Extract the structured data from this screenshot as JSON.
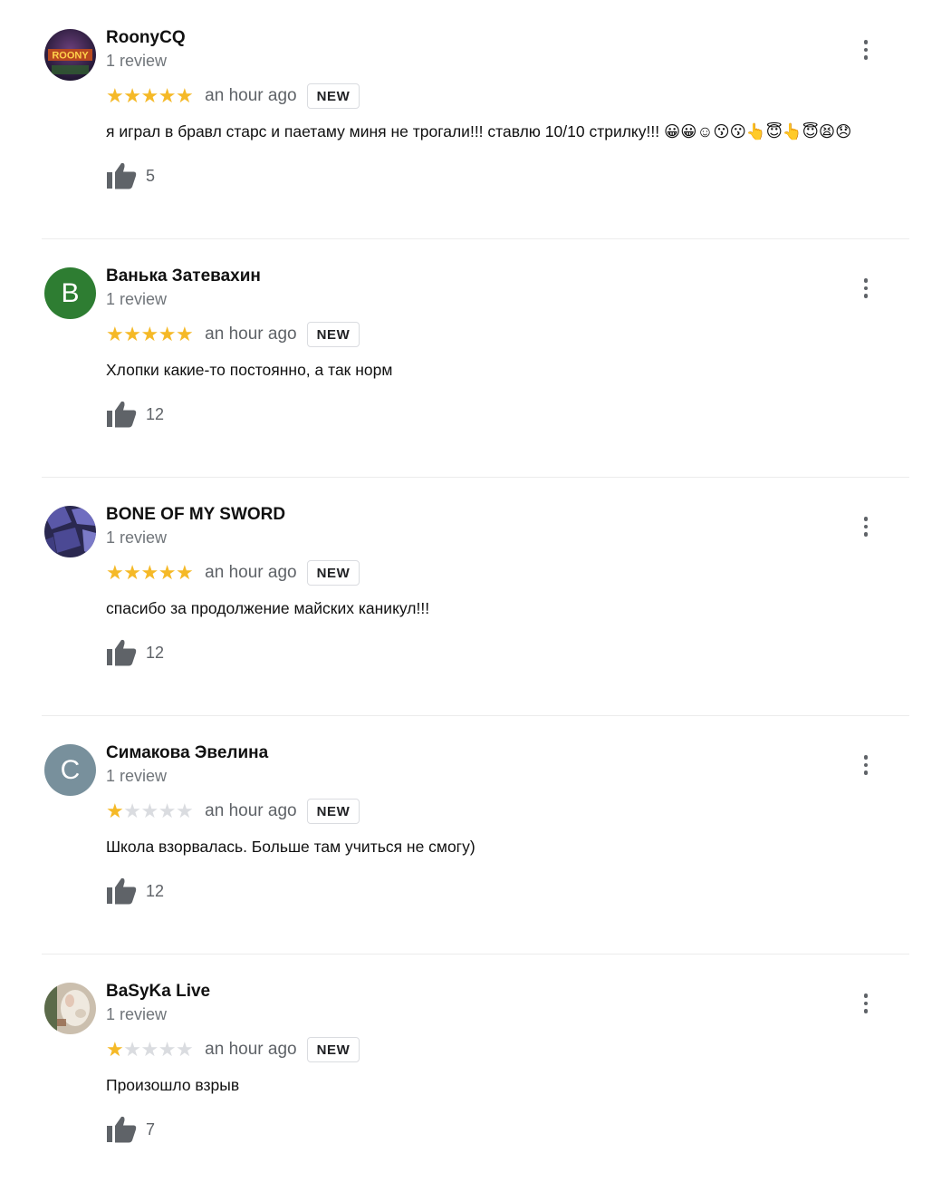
{
  "reviews": [
    {
      "author": "RoonyCQ",
      "review_count": "1 review",
      "rating": 5,
      "time": "an hour ago",
      "badge": "NEW",
      "text": "я играл в бравл старс и паетаму миня не трогали!!! ставлю 10/10 стрилку!!! 😀😀☺😗😗👆😇👆😇😫😞",
      "likes": "5",
      "avatar": {
        "type": "image",
        "text": "ROONY",
        "color": "#3a2a4a"
      }
    },
    {
      "author": "Ванька Затевахин",
      "review_count": "1 review",
      "rating": 5,
      "time": "an hour ago",
      "badge": "NEW",
      "text": "Хлопки какие-то постоянно, а так норм",
      "likes": "12",
      "avatar": {
        "type": "letter",
        "letter": "B",
        "color": "#2e7d32"
      }
    },
    {
      "author": "BONE OF MY SWORD",
      "review_count": "1 review",
      "rating": 5,
      "time": "an hour ago",
      "badge": "NEW",
      "text": "спасибо за продолжение майских каникул!!!",
      "likes": "12",
      "avatar": {
        "type": "image",
        "color": "#4a4a8a"
      }
    },
    {
      "author": "Симакова Эвелина",
      "review_count": "1 review",
      "rating": 1,
      "time": "an hour ago",
      "badge": "NEW",
      "text": "Школа взорвалась. Больше там учиться не смогу)",
      "likes": "12",
      "avatar": {
        "type": "letter",
        "letter": "C",
        "color": "#78909c"
      }
    },
    {
      "author": "BaSyKa Live",
      "review_count": "1 review",
      "rating": 1,
      "time": "an hour ago",
      "badge": "NEW",
      "text": "Произошло взрыв",
      "likes": "7",
      "avatar": {
        "type": "image",
        "color": "#d8cfc4"
      }
    }
  ],
  "colors": {
    "star_on": "#f5b927",
    "star_off": "#dadce0",
    "badge_border": "#dadce0"
  }
}
